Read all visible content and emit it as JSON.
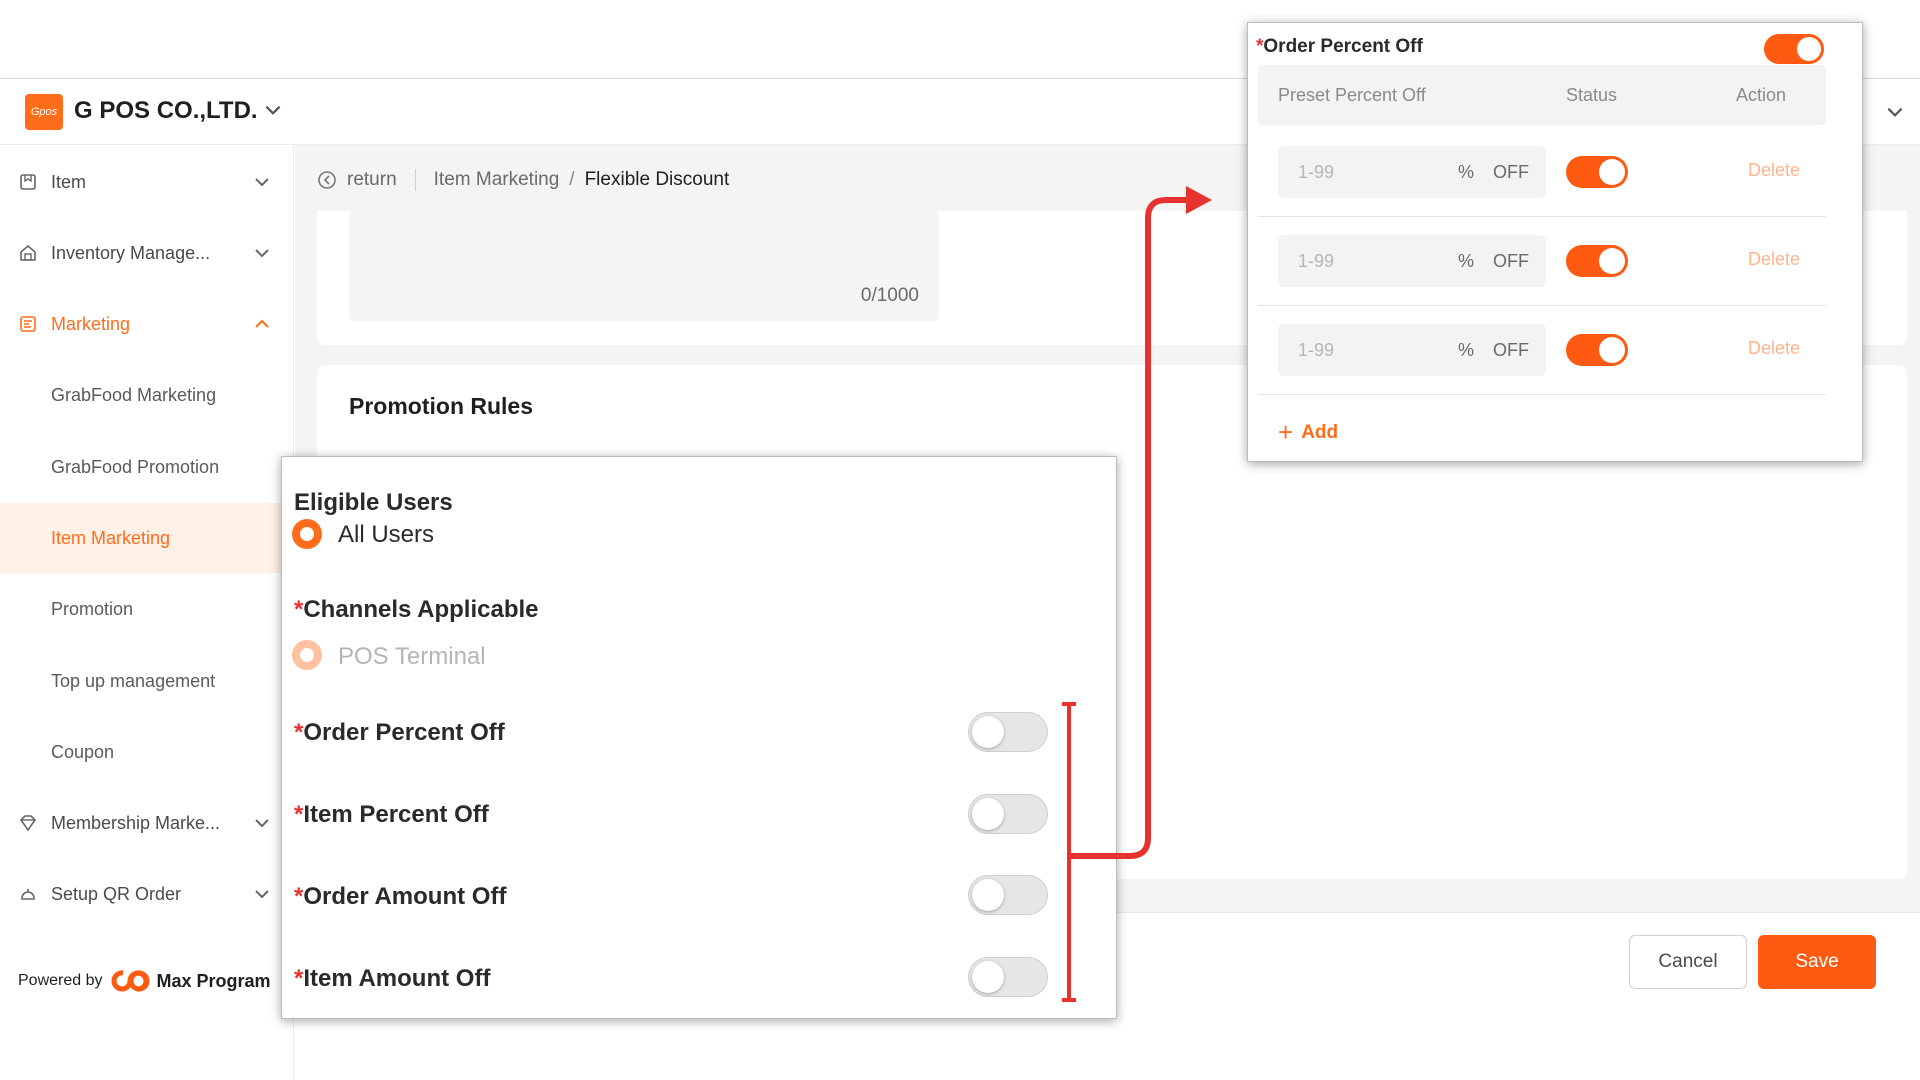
{
  "header": {
    "logo_text": "Gpos",
    "company": "G POS CO.,LTD."
  },
  "sidebar": {
    "items": [
      {
        "label": "Item",
        "icon": "item-icon"
      },
      {
        "label": "Inventory Manage...",
        "icon": "inventory-icon"
      },
      {
        "label": "Marketing",
        "icon": "marketing-icon"
      },
      {
        "label": "GrabFood Marketing"
      },
      {
        "label": "GrabFood Promotion"
      },
      {
        "label": "Item Marketing"
      },
      {
        "label": "Promotion"
      },
      {
        "label": "Top up management"
      },
      {
        "label": "Coupon"
      },
      {
        "label": "Membership Marke...",
        "icon": "membership-icon"
      },
      {
        "label": "Setup QR Order",
        "icon": "qr-order-icon"
      }
    ],
    "powered_by": "Powered by",
    "brand": "Max Program"
  },
  "breadcrumb": {
    "return": "return",
    "parent": "Item Marketing",
    "separator": "/",
    "current": "Flexible Discount"
  },
  "description": {
    "counter": "0/1000"
  },
  "rules": {
    "title": "Promotion Rules"
  },
  "eligible": {
    "title": "Eligible Users",
    "option": "All Users",
    "channels_title": "Channels Applicable",
    "channel_option": "POS Terminal",
    "toggles": [
      {
        "label": "Order Percent Off",
        "on": false
      },
      {
        "label": "Item Percent Off",
        "on": false
      },
      {
        "label": "Order Amount Off",
        "on": false
      },
      {
        "label": "Item Amount Off",
        "on": false
      }
    ],
    "required_mark": "*"
  },
  "order_percent": {
    "title": "Order Percent Off",
    "enabled": true,
    "columns": [
      "Preset Percent Off",
      "Status",
      "Action"
    ],
    "rows": [
      {
        "placeholder": "1-99",
        "unit": "%",
        "suffix": "OFF",
        "status": true,
        "action": "Delete"
      },
      {
        "placeholder": "1-99",
        "unit": "%",
        "suffix": "OFF",
        "status": true,
        "action": "Delete"
      },
      {
        "placeholder": "1-99",
        "unit": "%",
        "suffix": "OFF",
        "status": true,
        "action": "Delete"
      }
    ],
    "add_label": "Add"
  },
  "footer": {
    "cancel": "Cancel",
    "save": "Save"
  },
  "colors": {
    "accent": "#ff6c1a",
    "save": "#ff5a12",
    "annotation": "#e8322f"
  }
}
